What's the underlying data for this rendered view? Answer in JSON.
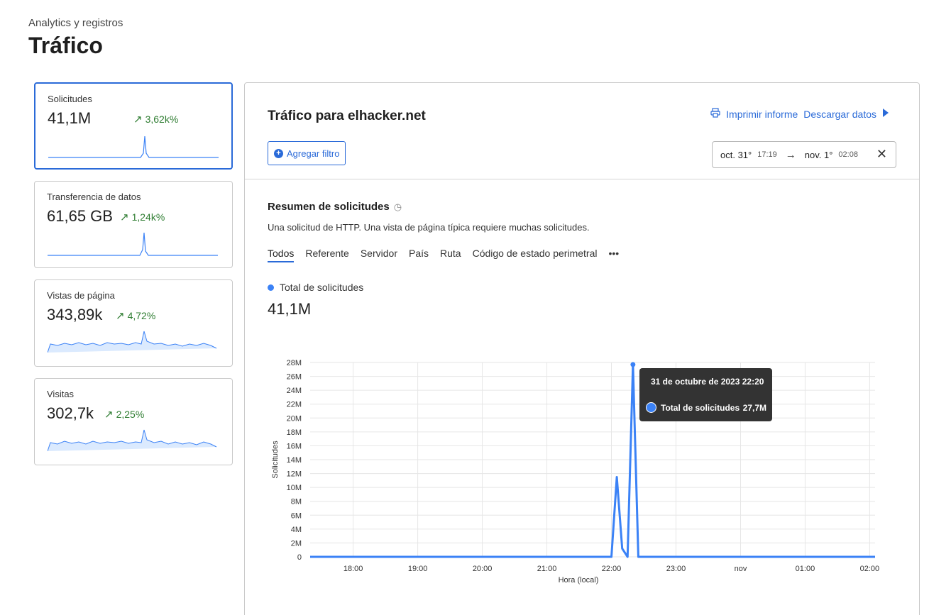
{
  "header": {
    "breadcrumb": "Analytics y registros",
    "title": "Tráfico"
  },
  "cards": [
    {
      "label": "Solicitudes",
      "value": "41,1M",
      "change": "3,62k%"
    },
    {
      "label": "Transferencia de datos",
      "value": "61,65 GB",
      "change": "1,24k%"
    },
    {
      "label": "Vistas de página",
      "value": "343,89k",
      "change": "4,72%"
    },
    {
      "label": "Visitas",
      "value": "302,7k",
      "change": "2,25%"
    }
  ],
  "panel": {
    "title": "Tráfico para elhacker.net",
    "print_label": "Imprimir informe",
    "download_label": "Descargar datos",
    "add_filter_label": "Agregar filtro",
    "date_range": {
      "from_date": "oct. 31°",
      "from_time": "17:19",
      "to_date": "nov. 1°",
      "to_time": "02:08"
    }
  },
  "summary": {
    "title": "Resumen de solicitudes",
    "description": "Una solicitud de HTTP. Una vista de página típica requiere muchas solicitudes.",
    "tabs": [
      "Todos",
      "Referente",
      "Servidor",
      "País",
      "Ruta",
      "Código de estado perimetral",
      "•••"
    ],
    "legend_label": "Total de solicitudes",
    "total_value": "41,1M"
  },
  "tooltip": {
    "title": "31 de octubre de 2023 22:20",
    "label": "Total de solicitudes",
    "value": "27,7M"
  },
  "colors": {
    "accent": "#2a6ad8",
    "series": "#3b82f6",
    "positive": "#2f7d32"
  },
  "chart_data": {
    "type": "line",
    "title": "",
    "xlabel": "Hora (local)",
    "ylabel": "Solicitudes",
    "y_tick_labels": [
      "0",
      "2M",
      "4M",
      "6M",
      "8M",
      "10M",
      "12M",
      "14M",
      "16M",
      "18M",
      "20M",
      "22M",
      "24M",
      "26M",
      "28M"
    ],
    "x_tick_labels": [
      "18:00",
      "19:00",
      "20:00",
      "21:00",
      "22:00",
      "23:00",
      "nov",
      "01:00",
      "02:00"
    ],
    "ylim": [
      0,
      28000000
    ],
    "grid": true,
    "series": [
      {
        "name": "Total de solicitudes",
        "x": [
          "17:20",
          "18:00",
          "19:00",
          "20:00",
          "21:00",
          "22:00",
          "22:05",
          "22:10",
          "22:15",
          "22:20",
          "22:25",
          "23:00",
          "00:00",
          "01:00",
          "02:00",
          "02:05"
        ],
        "values": [
          0,
          0,
          0,
          0,
          0,
          0,
          11500000,
          1200000,
          0,
          27700000,
          0,
          0,
          0,
          0,
          0,
          0
        ]
      }
    ]
  }
}
